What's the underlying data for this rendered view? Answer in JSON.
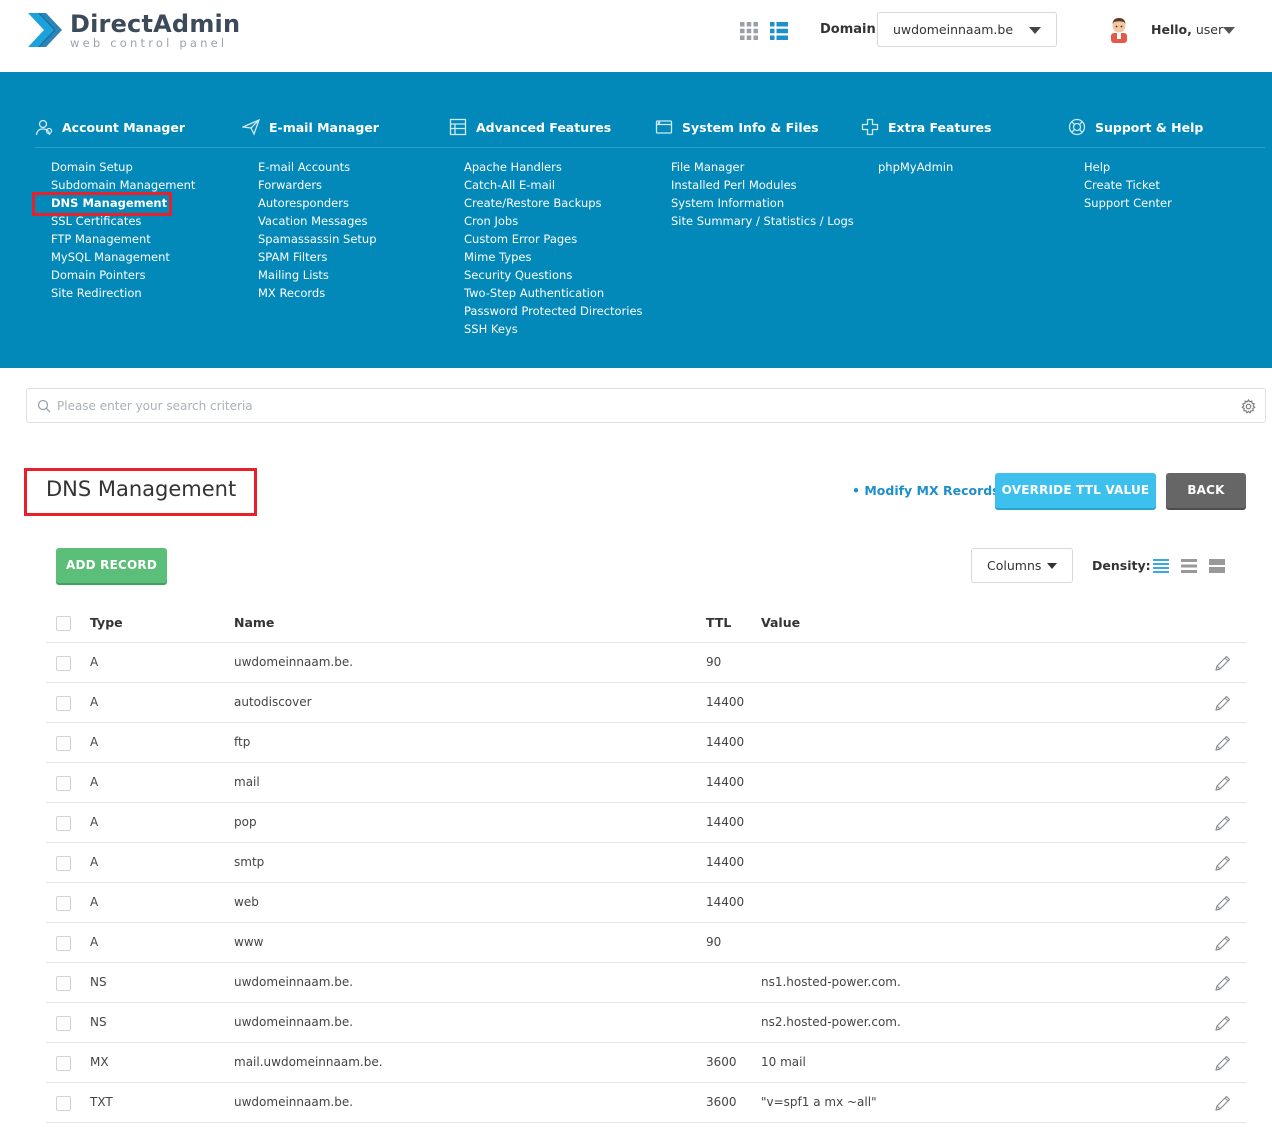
{
  "header": {
    "logo_title": "DirectAdmin",
    "logo_subtitle": "web control panel",
    "domain_label": "Domain",
    "domain_value": "uwdomeinnaam.be",
    "greeting": "Hello,",
    "user": "user"
  },
  "menu": {
    "columns": [
      {
        "title": "Account Manager",
        "icon": "account-icon",
        "items": [
          "Domain Setup",
          "Subdomain Management",
          "DNS Management",
          "SSL Certificates",
          "FTP Management",
          "MySQL Management",
          "Domain Pointers",
          "Site Redirection"
        ]
      },
      {
        "title": "E-mail Manager",
        "icon": "paper-plane-icon",
        "items": [
          "E-mail Accounts",
          "Forwarders",
          "Autoresponders",
          "Vacation Messages",
          "Spamassassin Setup",
          "SPAM Filters",
          "Mailing Lists",
          "MX Records"
        ]
      },
      {
        "title": "Advanced Features",
        "icon": "advanced-icon",
        "items": [
          "Apache Handlers",
          "Catch-All E-mail",
          "Create/Restore Backups",
          "Cron Jobs",
          "Custom Error Pages",
          "Mime Types",
          "Security Questions",
          "Two-Step Authentication",
          "Password Protected Directories",
          "SSH Keys"
        ]
      },
      {
        "title": "System Info & Files",
        "icon": "system-icon",
        "items": [
          "File Manager",
          "Installed Perl Modules",
          "System Information",
          "Site Summary / Statistics / Logs"
        ]
      },
      {
        "title": "Extra Features",
        "icon": "plus-icon",
        "items": [
          "phpMyAdmin"
        ]
      },
      {
        "title": "Support & Help",
        "icon": "lifebuoy-icon",
        "items": [
          "Help",
          "Create Ticket",
          "Support Center"
        ]
      }
    ],
    "active_item": "DNS Management"
  },
  "search": {
    "placeholder": "Please enter your search criteria"
  },
  "page": {
    "title": "DNS Management",
    "modify_mx_link": "• Modify MX Records",
    "override_ttl_button": "OVERRIDE TTL VALUE",
    "back_button": "BACK",
    "add_record_button": "ADD RECORD",
    "columns_button": "Columns",
    "density_label": "Density:"
  },
  "table": {
    "headers": {
      "type": "Type",
      "name": "Name",
      "ttl": "TTL",
      "value": "Value"
    },
    "rows": [
      {
        "type": "A",
        "name": "uwdomeinnaam.be.",
        "ttl": "90",
        "value": ""
      },
      {
        "type": "A",
        "name": "autodiscover",
        "ttl": "14400",
        "value": ""
      },
      {
        "type": "A",
        "name": "ftp",
        "ttl": "14400",
        "value": ""
      },
      {
        "type": "A",
        "name": "mail",
        "ttl": "14400",
        "value": ""
      },
      {
        "type": "A",
        "name": "pop",
        "ttl": "14400",
        "value": ""
      },
      {
        "type": "A",
        "name": "smtp",
        "ttl": "14400",
        "value": ""
      },
      {
        "type": "A",
        "name": "web",
        "ttl": "14400",
        "value": ""
      },
      {
        "type": "A",
        "name": "www",
        "ttl": "90",
        "value": ""
      },
      {
        "type": "NS",
        "name": "uwdomeinnaam.be.",
        "ttl": "",
        "value": "ns1.hosted-power.com."
      },
      {
        "type": "NS",
        "name": "uwdomeinnaam.be.",
        "ttl": "",
        "value": "ns2.hosted-power.com."
      },
      {
        "type": "MX",
        "name": "mail.uwdomeinnaam.be.",
        "ttl": "3600",
        "value": "10 mail"
      },
      {
        "type": "TXT",
        "name": "uwdomeinnaam.be.",
        "ttl": "3600",
        "value": "\"v=spf1 a mx ~all\""
      }
    ]
  },
  "colors": {
    "menu_bg": "#0288b9",
    "highlight": "#e8202a",
    "accent": "#3ec0ef",
    "add_green": "#5bbf7a",
    "back_gray": "#666666"
  }
}
